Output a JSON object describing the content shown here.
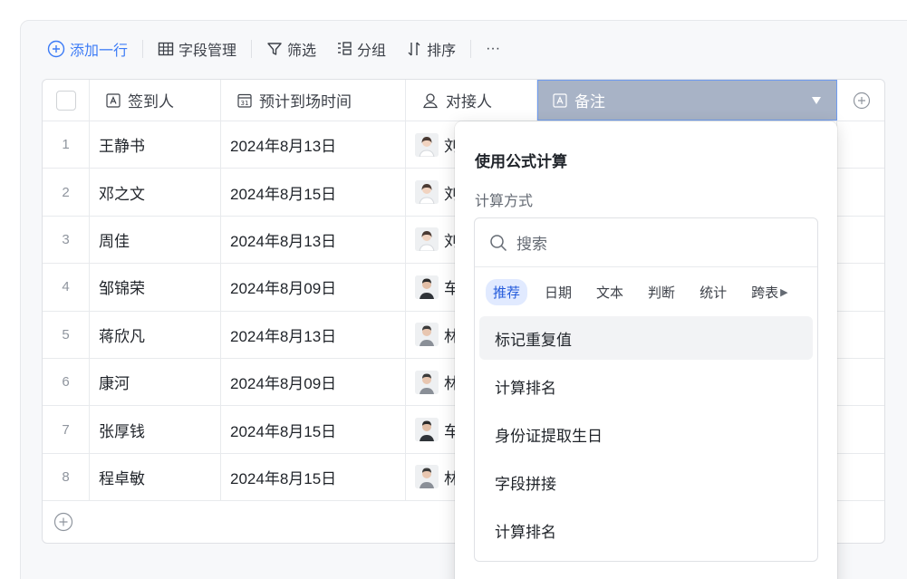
{
  "toolbar": {
    "add_row": "添加一行",
    "field_manage": "字段管理",
    "filter": "筛选",
    "group": "分组",
    "sort": "排序",
    "more": "···"
  },
  "table": {
    "columns": [
      {
        "label": "签到人",
        "icon": "text-field-icon"
      },
      {
        "label": "预计到场时间",
        "icon": "date-field-icon"
      },
      {
        "label": "对接人",
        "icon": "person-field-icon"
      },
      {
        "label": "备注",
        "icon": "text-field-icon"
      }
    ],
    "rows": [
      {
        "index": "1",
        "name": "王静书",
        "date": "2024年8月13日",
        "contact_initial": "刘",
        "avatar": "female"
      },
      {
        "index": "2",
        "name": "邓之文",
        "date": "2024年8月15日",
        "contact_initial": "刘",
        "avatar": "female"
      },
      {
        "index": "3",
        "name": "周佳",
        "date": "2024年8月13日",
        "contact_initial": "刘",
        "avatar": "female"
      },
      {
        "index": "4",
        "name": "邹锦荣",
        "date": "2024年8月09日",
        "contact_initial": "车",
        "avatar": "male-dark"
      },
      {
        "index": "5",
        "name": "蒋欣凡",
        "date": "2024年8月13日",
        "contact_initial": "林",
        "avatar": "male"
      },
      {
        "index": "6",
        "name": "康河",
        "date": "2024年8月09日",
        "contact_initial": "林",
        "avatar": "male"
      },
      {
        "index": "7",
        "name": "张厚钱",
        "date": "2024年8月15日",
        "contact_initial": "车",
        "avatar": "male-dark"
      },
      {
        "index": "8",
        "name": "程卓敏",
        "date": "2024年8月15日",
        "contact_initial": "林",
        "avatar": "male"
      }
    ]
  },
  "dropdown": {
    "title": "使用公式计算",
    "subtitle": "计算方式",
    "search_placeholder": "搜索",
    "tabs": [
      "推荐",
      "日期",
      "文本",
      "判断",
      "统计",
      "跨表"
    ],
    "items": [
      "标记重复值",
      "计算排名",
      "身份证提取生日",
      "字段拼接",
      "计算排名"
    ]
  },
  "colors": {
    "accent": "#3c7bf6",
    "header_selected": "#a8b3c6",
    "tab_active_bg": "#e1eaff"
  }
}
